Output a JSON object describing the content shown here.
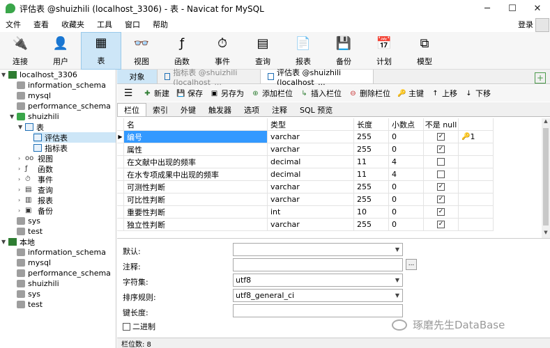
{
  "window": {
    "title": "评估表 @shuizhili (localhost_3306) - 表 - Navicat for MySQL"
  },
  "menu": [
    "文件",
    "查看",
    "收藏夹",
    "工具",
    "窗口",
    "帮助"
  ],
  "login_label": "登录",
  "toolbar": [
    {
      "label": "连接",
      "icon": "connection-icon"
    },
    {
      "label": "用户",
      "icon": "user-icon"
    },
    {
      "label": "表",
      "icon": "table-icon",
      "active": true
    },
    {
      "label": "视图",
      "icon": "view-icon"
    },
    {
      "label": "函数",
      "icon": "function-icon"
    },
    {
      "label": "事件",
      "icon": "event-icon"
    },
    {
      "label": "查询",
      "icon": "query-icon"
    },
    {
      "label": "报表",
      "icon": "report-icon"
    },
    {
      "label": "备份",
      "icon": "backup-icon"
    },
    {
      "label": "计划",
      "icon": "schedule-icon"
    },
    {
      "label": "模型",
      "icon": "model-icon"
    }
  ],
  "sidebar": {
    "c1": "localhost_3306",
    "c1_dbs": [
      "information_schema",
      "mysql",
      "performance_schema"
    ],
    "c1_open": "shuizhili",
    "tables_group": "表",
    "tables": [
      "评估表",
      "指标表"
    ],
    "objects": [
      "视图",
      "函数",
      "事件",
      "查询",
      "报表",
      "备份"
    ],
    "c1_more": [
      "sys",
      "test"
    ],
    "c2": "本地",
    "c2_dbs": [
      "information_schema",
      "mysql",
      "performance_schema",
      "shuizhili",
      "sys",
      "test"
    ]
  },
  "tabs": {
    "object": "对象",
    "t1": "指标表 @shuizhili (localhost_...",
    "t2": "评估表 @shuizhili (localhost_..."
  },
  "design_toolbar": {
    "new": "新建",
    "save": "保存",
    "save_as": "另存为",
    "add_field": "添加栏位",
    "insert_field": "插入栏位",
    "delete_field": "删除栏位",
    "primary_key": "主键",
    "move_up": "上移",
    "move_down": "下移"
  },
  "subtabs": [
    "栏位",
    "索引",
    "外键",
    "触发器",
    "选项",
    "注释",
    "SQL 预览"
  ],
  "grid": {
    "headers": {
      "name": "名",
      "type": "类型",
      "length": "长度",
      "decimals": "小数点",
      "not_null": "不是 null"
    },
    "rows": [
      {
        "name": "编号",
        "type": "varchar",
        "length": "255",
        "decimals": "0",
        "not_null": true,
        "key": "1"
      },
      {
        "name": "属性",
        "type": "varchar",
        "length": "255",
        "decimals": "0",
        "not_null": true,
        "key": ""
      },
      {
        "name": "在文献中出现的频率",
        "type": "decimal",
        "length": "11",
        "decimals": "4",
        "not_null": false,
        "key": ""
      },
      {
        "name": "在水专项成果中出现的频率",
        "type": "decimal",
        "length": "11",
        "decimals": "4",
        "not_null": false,
        "key": ""
      },
      {
        "name": "可测性判断",
        "type": "varchar",
        "length": "255",
        "decimals": "0",
        "not_null": true,
        "key": ""
      },
      {
        "name": "可比性判断",
        "type": "varchar",
        "length": "255",
        "decimals": "0",
        "not_null": true,
        "key": ""
      },
      {
        "name": "重要性判断",
        "type": "int",
        "length": "10",
        "decimals": "0",
        "not_null": true,
        "key": ""
      },
      {
        "name": "独立性判断",
        "type": "varchar",
        "length": "255",
        "decimals": "0",
        "not_null": true,
        "key": ""
      }
    ]
  },
  "props": {
    "default_label": "默认:",
    "default_value": "",
    "comment_label": "注释:",
    "comment_value": "",
    "charset_label": "字符集:",
    "charset_value": "utf8",
    "collation_label": "排序规则:",
    "collation_value": "utf8_general_ci",
    "keylen_label": "键长度:",
    "keylen_value": "",
    "binary_label": "二进制",
    "binary_checked": false
  },
  "watermark": "琢磨先生DataBase",
  "status": "栏位数: 8"
}
